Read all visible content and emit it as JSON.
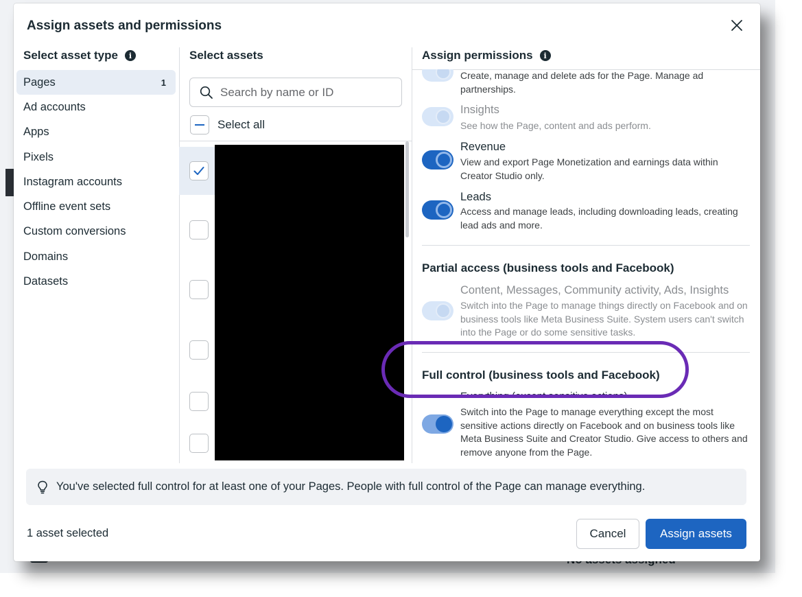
{
  "background": {
    "bottom_text": "No assets assigned"
  },
  "modal": {
    "title": "Assign assets and permissions",
    "close_icon": "close-icon"
  },
  "asset_types": {
    "heading": "Select asset type",
    "items": [
      {
        "label": "Pages",
        "count": "1",
        "active": true
      },
      {
        "label": "Ad accounts"
      },
      {
        "label": "Apps"
      },
      {
        "label": "Pixels"
      },
      {
        "label": "Instagram accounts"
      },
      {
        "label": "Offline event sets"
      },
      {
        "label": "Custom conversions"
      },
      {
        "label": "Domains"
      },
      {
        "label": "Datasets"
      }
    ]
  },
  "assets": {
    "heading": "Select assets",
    "search_placeholder": "Search by name or ID",
    "select_all_label": "Select all",
    "rows": [
      {
        "checked": true
      },
      {
        "checked": false
      },
      {
        "checked": false
      },
      {
        "checked": false
      },
      {
        "checked": false
      },
      {
        "checked": false
      }
    ]
  },
  "permissions": {
    "heading": "Assign permissions",
    "top_partial_desc": "Create, manage and delete ads for the Page. Manage ad partnerships.",
    "items": [
      {
        "title": "Insights",
        "desc": "See how the Page, content and ads perform.",
        "state": "off"
      },
      {
        "title": "Revenue",
        "desc": "View and export Page Monetization and earnings data within Creator Studio only.",
        "state": "on"
      },
      {
        "title": "Leads",
        "desc": "Access and manage leads, including downloading leads, creating lead ads and more.",
        "state": "on"
      }
    ],
    "partial_access": {
      "heading": "Partial access (business tools and Facebook)",
      "title": "Content, Messages, Community activity, Ads, Insights",
      "desc": "Switch into the Page to manage things directly on Facebook and on business tools like Meta Business Suite. System users can't switch into the Page or do some sensitive tasks.",
      "state": "off"
    },
    "full_control": {
      "heading": "Full control (business tools and Facebook)",
      "title": "Everything (except sensitive actions)",
      "desc": "Switch into the Page to manage everything except the most sensitive actions directly on Facebook and on business tools like Meta Business Suite and Creator Studio. Give access to others and remove anyone from the Page.",
      "state": "on"
    },
    "highlight_color": "#6a2bb5"
  },
  "notice": {
    "icon": "lightbulb-icon",
    "text": "You've selected full control for at least one of your Pages. People with full control of the Page can manage everything."
  },
  "footer": {
    "selected_count": "1 asset selected",
    "cancel_label": "Cancel",
    "assign_label": "Assign assets"
  },
  "colors": {
    "primary": "#1d65c1",
    "toggle_off": "#d8e6f8",
    "selected_bg": "#e7edf5"
  }
}
